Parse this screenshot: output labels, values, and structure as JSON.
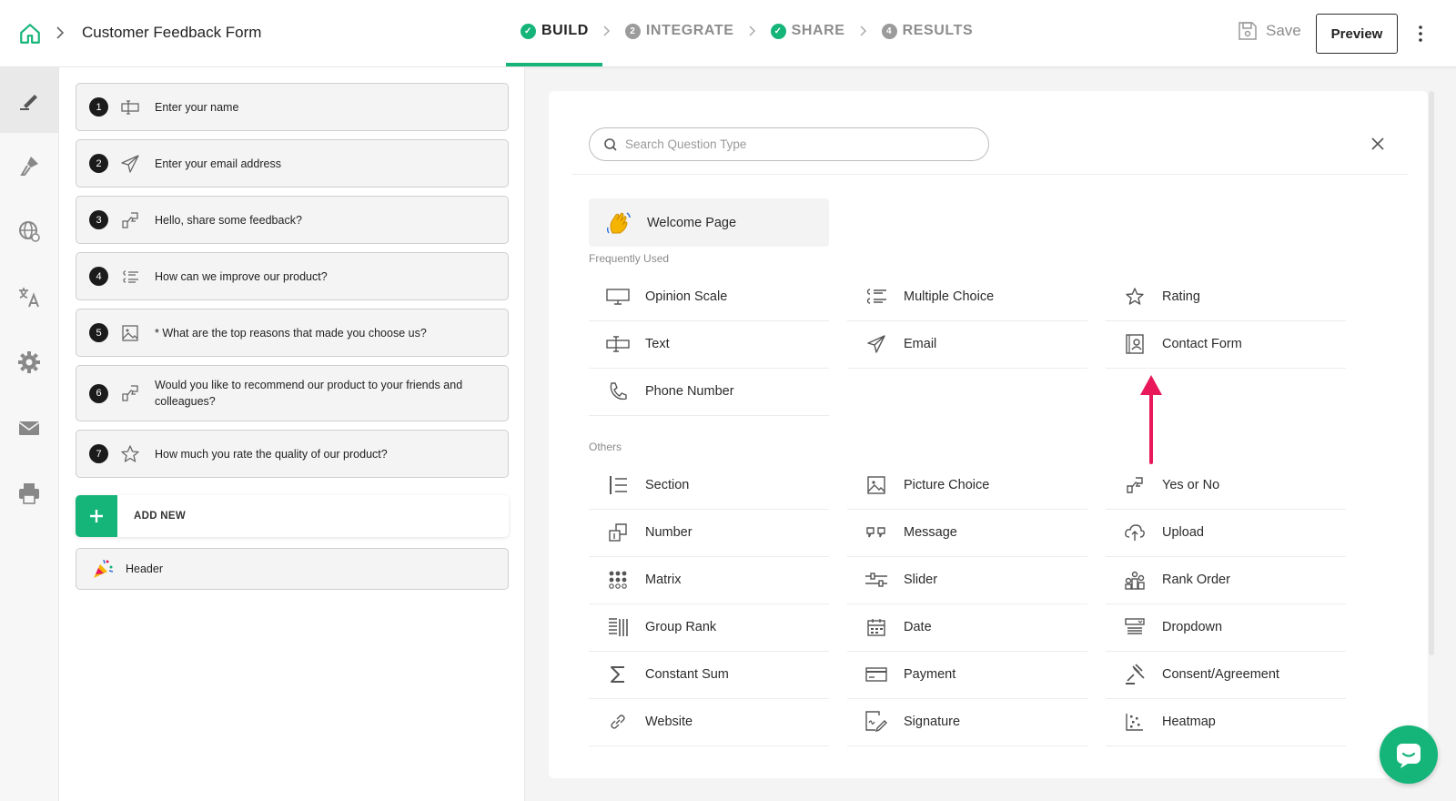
{
  "header": {
    "form_title": "Customer Feedback Form",
    "steps": [
      {
        "label": "BUILD",
        "badge": "✓"
      },
      {
        "label": "INTEGRATE",
        "badge": "2"
      },
      {
        "label": "SHARE",
        "badge": "✓"
      },
      {
        "label": "RESULTS",
        "badge": "4"
      }
    ],
    "save_label": "Save",
    "preview_label": "Preview"
  },
  "colors": {
    "accent": "#15b57a",
    "arrow": "#e8185a"
  },
  "questions": [
    {
      "num": "1",
      "text": "Enter your name"
    },
    {
      "num": "2",
      "text": "Enter your email address"
    },
    {
      "num": "3",
      "text": "Hello, share some feedback?"
    },
    {
      "num": "4",
      "text": "How can we improve our product?"
    },
    {
      "num": "5",
      "text": "* What are the top reasons that made you choose us?"
    },
    {
      "num": "6",
      "text": "Would you like to recommend our product to your friends and colleagues?"
    },
    {
      "num": "7",
      "text": "How much you rate the quality of our product?"
    }
  ],
  "add_new_label": "ADD NEW",
  "header_item_label": "Header",
  "type_panel": {
    "search_placeholder": "Search Question Type",
    "welcome_label": "Welcome Page",
    "frequently_used_label": "Frequently Used",
    "others_label": "Others",
    "frequently_used": [
      "Opinion Scale",
      "Multiple Choice",
      "Rating",
      "Text",
      "Email",
      "Contact Form",
      "Phone Number"
    ],
    "others": [
      "Section",
      "Picture Choice",
      "Yes or No",
      "Number",
      "Message",
      "Upload",
      "Matrix",
      "Slider",
      "Rank Order",
      "Group Rank",
      "Date",
      "Dropdown",
      "Constant Sum",
      "Payment",
      "Consent/Agreement",
      "Website",
      "Signature",
      "Heatmap"
    ]
  }
}
